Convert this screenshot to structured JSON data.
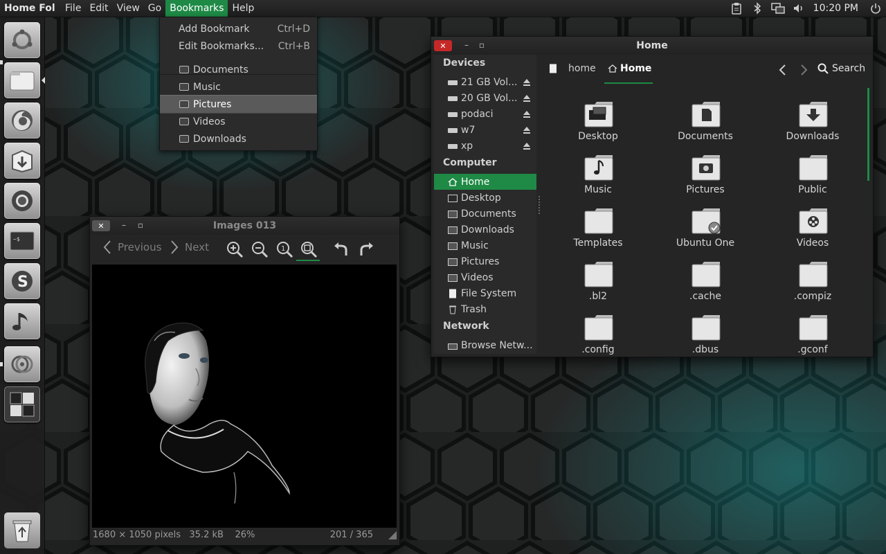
{
  "panel": {
    "app_title": "Home Fol",
    "menus": [
      "File",
      "Edit",
      "View",
      "Go",
      "Bookmarks",
      "Help"
    ],
    "active_menu": "Bookmarks",
    "clock": "10:20 PM",
    "indicator_icons": [
      "clipboard-icon",
      "bluetooth-icon",
      "network-icon",
      "volume-icon",
      "power-icon"
    ]
  },
  "launcher": {
    "items": [
      "ubuntu-dash",
      "files",
      "firefox",
      "software-center",
      "chromium",
      "terminal",
      "skype",
      "music-player",
      "disc-burner",
      "workspace-switcher"
    ],
    "trash": "trash"
  },
  "bookmarks_menu": {
    "add": "Add Bookmark",
    "add_accel": "Ctrl+D",
    "edit": "Edit Bookmarks...",
    "edit_accel": "Ctrl+B",
    "items": [
      "Documents",
      "Music",
      "Pictures",
      "Videos",
      "Downloads"
    ],
    "highlighted": "Pictures"
  },
  "file_manager": {
    "title": "Home",
    "sidebar": {
      "devices_header": "Devices",
      "devices": [
        "21 GB Vol...",
        "20 GB Vol...",
        "podaci",
        "w7",
        "xp"
      ],
      "computer_header": "Computer",
      "computer": [
        "Home",
        "Desktop",
        "Documents",
        "Downloads",
        "Music",
        "Pictures",
        "Videos",
        "File System",
        "Trash"
      ],
      "selected": "Home",
      "network_header": "Network",
      "network": [
        "Browse Netw..."
      ]
    },
    "path": [
      "home",
      "Home"
    ],
    "search_label": "Search",
    "files": [
      "Desktop",
      "Documents",
      "Downloads",
      "Music",
      "Pictures",
      "Public",
      "Templates",
      "Ubuntu One",
      "Videos",
      ".bl2",
      ".cache",
      ".compiz",
      ".config",
      ".dbus",
      ".gconf"
    ]
  },
  "image_viewer": {
    "title": "Images 013",
    "previous": "Previous",
    "next": "Next",
    "dimensions": "1680 × 1050 pixels",
    "size": "35.2 kB",
    "zoom": "26%",
    "counter": "201 / 365"
  },
  "colors": {
    "accent": "#1e8a45",
    "close": "#c62828",
    "panel": "#252525"
  }
}
